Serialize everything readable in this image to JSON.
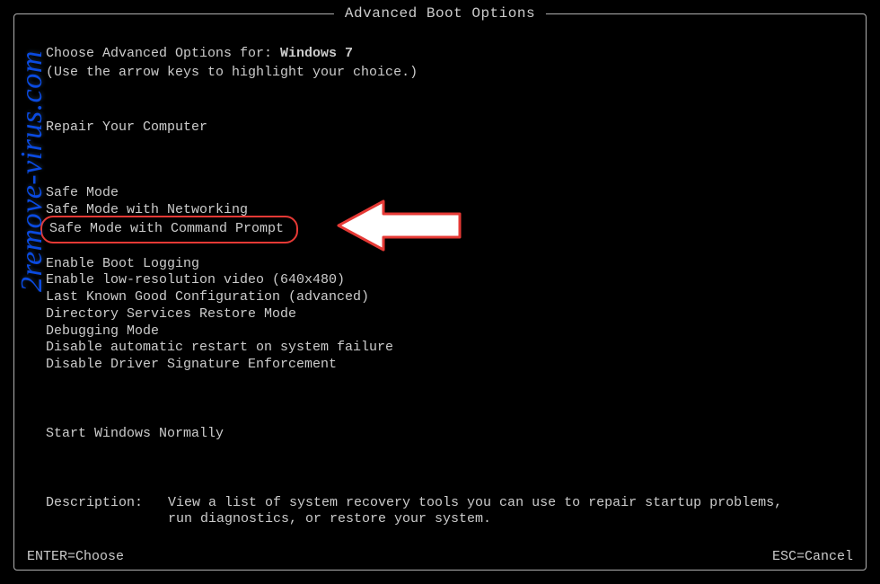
{
  "title": "Advanced Boot Options",
  "choose_prefix": "Choose Advanced Options for: ",
  "os_name": "Windows 7",
  "hint": "(Use the arrow keys to highlight your choice.)",
  "repair": "Repair Your Computer",
  "group1": [
    "Safe Mode",
    "Safe Mode with Networking",
    "Safe Mode with Command Prompt"
  ],
  "group2": [
    "Enable Boot Logging",
    "Enable low-resolution video (640x480)",
    "Last Known Good Configuration (advanced)",
    "Directory Services Restore Mode",
    "Debugging Mode",
    "Disable automatic restart on system failure",
    "Disable Driver Signature Enforcement"
  ],
  "group3": [
    "Start Windows Normally"
  ],
  "description_label": "Description:",
  "description_text": "View a list of system recovery tools you can use to repair startup problems, run diagnostics, or restore your system.",
  "footer_left": "ENTER=Choose",
  "footer_right": "ESC=Cancel",
  "watermark": "2remove-virus.com"
}
